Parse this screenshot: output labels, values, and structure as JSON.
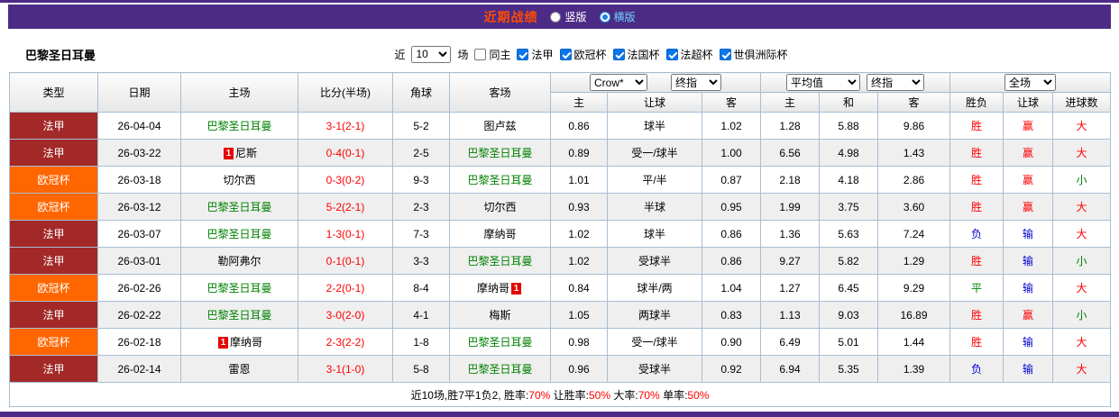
{
  "topbar": {
    "title": "近期战绩",
    "radios": [
      {
        "label": "竖版",
        "checked": false
      },
      {
        "label": "横版",
        "checked": true
      }
    ]
  },
  "filterbar": {
    "team": "巴黎圣日耳曼",
    "near_label": "近",
    "count": "10",
    "games_label": "场",
    "checkboxes": [
      {
        "label": "同主",
        "checked": false
      },
      {
        "label": "法甲",
        "checked": true
      },
      {
        "label": "欧冠杯",
        "checked": true
      },
      {
        "label": "法国杯",
        "checked": true
      },
      {
        "label": "法超杯",
        "checked": true
      },
      {
        "label": "世俱洲际杯",
        "checked": true
      }
    ]
  },
  "table": {
    "static_headers": [
      "类型",
      "日期",
      "主场",
      "比分(半场)",
      "角球",
      "客场"
    ],
    "selects": {
      "bookmaker": "Crow*",
      "asia_final": "终指",
      "europe_avg": "平均值",
      "europe_final": "终指",
      "fullmatch": "全场"
    },
    "sub_headers": [
      "主",
      "让球",
      "客",
      "主",
      "和",
      "客",
      "胜负",
      "让球",
      "进球数"
    ],
    "colors": {
      "league": {
        "法甲": "#a32929",
        "欧冠杯": "#ff6600"
      },
      "result": {
        "胜": "#ff0000",
        "平": "#008000",
        "负": "#0000cc",
        "赢": "#ff0000",
        "输": "#0000cc",
        "大": "#ff0000",
        "小": "#008000"
      },
      "team_highlight": "#008000",
      "score": "#ff0000"
    },
    "rows": [
      {
        "league": "法甲",
        "date": "26-04-04",
        "home": "巴黎圣日耳曼",
        "home_hl": true,
        "home_card": "",
        "home_card_pos": "",
        "score": "3-1(2-1)",
        "corner": "5-2",
        "away": "图卢兹",
        "away_hl": false,
        "away_card": "",
        "away_card_pos": "",
        "asia": [
          "0.86",
          "球半",
          "1.02"
        ],
        "europe": [
          "1.28",
          "5.88",
          "9.86"
        ],
        "outcome": [
          "胜",
          "赢",
          "大"
        ]
      },
      {
        "league": "法甲",
        "date": "26-03-22",
        "home": "尼斯",
        "home_hl": false,
        "home_card": "1",
        "home_card_pos": "before",
        "score": "0-4(0-1)",
        "corner": "2-5",
        "away": "巴黎圣日耳曼",
        "away_hl": true,
        "away_card": "",
        "away_card_pos": "",
        "asia": [
          "0.89",
          "受一/球半",
          "1.00"
        ],
        "europe": [
          "6.56",
          "4.98",
          "1.43"
        ],
        "outcome": [
          "胜",
          "赢",
          "大"
        ]
      },
      {
        "league": "欧冠杯",
        "date": "26-03-18",
        "home": "切尔西",
        "home_hl": false,
        "home_card": "",
        "home_card_pos": "",
        "score": "0-3(0-2)",
        "corner": "9-3",
        "away": "巴黎圣日耳曼",
        "away_hl": true,
        "away_card": "",
        "away_card_pos": "",
        "asia": [
          "1.01",
          "平/半",
          "0.87"
        ],
        "europe": [
          "2.18",
          "4.18",
          "2.86"
        ],
        "outcome": [
          "胜",
          "赢",
          "小"
        ]
      },
      {
        "league": "欧冠杯",
        "date": "26-03-12",
        "home": "巴黎圣日耳曼",
        "home_hl": true,
        "home_card": "",
        "home_card_pos": "",
        "score": "5-2(2-1)",
        "corner": "2-3",
        "away": "切尔西",
        "away_hl": false,
        "away_card": "",
        "away_card_pos": "",
        "asia": [
          "0.93",
          "半球",
          "0.95"
        ],
        "europe": [
          "1.99",
          "3.75",
          "3.60"
        ],
        "outcome": [
          "胜",
          "赢",
          "大"
        ]
      },
      {
        "league": "法甲",
        "date": "26-03-07",
        "home": "巴黎圣日耳曼",
        "home_hl": true,
        "home_card": "",
        "home_card_pos": "",
        "score": "1-3(0-1)",
        "corner": "7-3",
        "away": "摩纳哥",
        "away_hl": false,
        "away_card": "",
        "away_card_pos": "",
        "asia": [
          "1.02",
          "球半",
          "0.86"
        ],
        "europe": [
          "1.36",
          "5.63",
          "7.24"
        ],
        "outcome": [
          "负",
          "输",
          "大"
        ]
      },
      {
        "league": "法甲",
        "date": "26-03-01",
        "home": "勒阿弗尔",
        "home_hl": false,
        "home_card": "",
        "home_card_pos": "",
        "score": "0-1(0-1)",
        "corner": "3-3",
        "away": "巴黎圣日耳曼",
        "away_hl": true,
        "away_card": "",
        "away_card_pos": "",
        "asia": [
          "1.02",
          "受球半",
          "0.86"
        ],
        "europe": [
          "9.27",
          "5.82",
          "1.29"
        ],
        "outcome": [
          "胜",
          "输",
          "小"
        ]
      },
      {
        "league": "欧冠杯",
        "date": "26-02-26",
        "home": "巴黎圣日耳曼",
        "home_hl": true,
        "home_card": "",
        "home_card_pos": "",
        "score": "2-2(0-1)",
        "corner": "8-4",
        "away": "摩纳哥",
        "away_hl": false,
        "away_card": "1",
        "away_card_pos": "after",
        "asia": [
          "0.84",
          "球半/两",
          "1.04"
        ],
        "europe": [
          "1.27",
          "6.45",
          "9.29"
        ],
        "outcome": [
          "平",
          "输",
          "大"
        ]
      },
      {
        "league": "法甲",
        "date": "26-02-22",
        "home": "巴黎圣日耳曼",
        "home_hl": true,
        "home_card": "",
        "home_card_pos": "",
        "score": "3-0(2-0)",
        "corner": "4-1",
        "away": "梅斯",
        "away_hl": false,
        "away_card": "",
        "away_card_pos": "",
        "asia": [
          "1.05",
          "两球半",
          "0.83"
        ],
        "europe": [
          "1.13",
          "9.03",
          "16.89"
        ],
        "outcome": [
          "胜",
          "赢",
          "小"
        ]
      },
      {
        "league": "欧冠杯",
        "date": "26-02-18",
        "home": "摩纳哥",
        "home_hl": false,
        "home_card": "1",
        "home_card_pos": "before",
        "score": "2-3(2-2)",
        "corner": "1-8",
        "away": "巴黎圣日耳曼",
        "away_hl": true,
        "away_card": "",
        "away_card_pos": "",
        "asia": [
          "0.98",
          "受一/球半",
          "0.90"
        ],
        "europe": [
          "6.49",
          "5.01",
          "1.44"
        ],
        "outcome": [
          "胜",
          "输",
          "大"
        ]
      },
      {
        "league": "法甲",
        "date": "26-02-14",
        "home": "雷恩",
        "home_hl": false,
        "home_card": "",
        "home_card_pos": "",
        "score": "3-1(1-0)",
        "corner": "5-8",
        "away": "巴黎圣日耳曼",
        "away_hl": true,
        "away_card": "",
        "away_card_pos": "",
        "asia": [
          "0.96",
          "受球半",
          "0.92"
        ],
        "europe": [
          "6.94",
          "5.35",
          "1.39"
        ],
        "outcome": [
          "负",
          "输",
          "大"
        ]
      }
    ],
    "summary": [
      {
        "text": "近10场,胜7平1负2, 胜率:",
        "red": false
      },
      {
        "text": "70%",
        "red": true
      },
      {
        "text": " 让胜率:",
        "red": false
      },
      {
        "text": "50%",
        "red": true
      },
      {
        "text": " 大率:",
        "red": false
      },
      {
        "text": "70%",
        "red": true
      },
      {
        "text": " 单率:",
        "red": false
      },
      {
        "text": "50%",
        "red": true
      }
    ]
  }
}
